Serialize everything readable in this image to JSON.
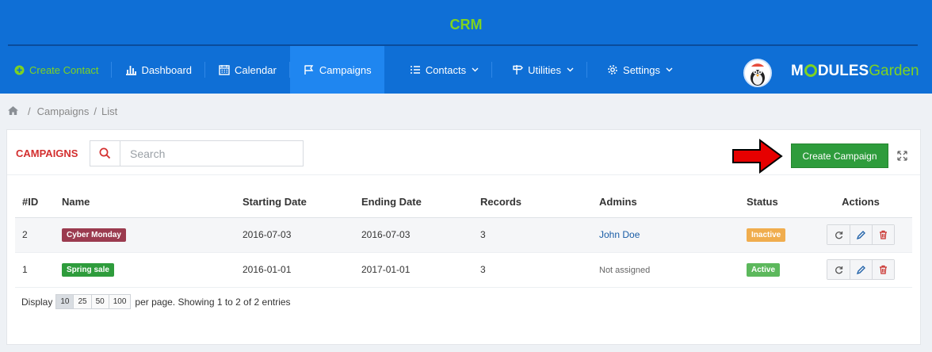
{
  "app": {
    "title": "CRM"
  },
  "nav": {
    "create_contact": "Create Contact",
    "items": [
      {
        "label": "Dashboard",
        "icon": "bar-chart-icon"
      },
      {
        "label": "Calendar",
        "icon": "calendar-icon"
      },
      {
        "label": "Campaigns",
        "icon": "flag-icon",
        "active": true
      },
      {
        "label": "Contacts",
        "icon": "list-icon",
        "dropdown": true
      },
      {
        "label": "Utilities",
        "icon": "signpost-icon",
        "dropdown": true
      },
      {
        "label": "Settings",
        "icon": "gear-icon",
        "dropdown": true
      }
    ],
    "logo": {
      "part1": "M",
      "part2": "DULES",
      "part3": "Garden"
    }
  },
  "breadcrumb": {
    "items": [
      "Campaigns",
      "List"
    ]
  },
  "card": {
    "title": "CAMPAIGNS",
    "search_placeholder": "Search",
    "create_button": "Create Campaign"
  },
  "table": {
    "headers": [
      "#ID",
      "Name",
      "Starting Date",
      "Ending Date",
      "Records",
      "Admins",
      "Status",
      "Actions"
    ],
    "rows": [
      {
        "id": "2",
        "name": "Cyber Monday",
        "name_color": "#9b3b4f",
        "start": "2016-07-03",
        "end": "2016-07-03",
        "records": "3",
        "admin": "John Doe",
        "status": "Inactive",
        "status_color": "#f0ad4e"
      },
      {
        "id": "1",
        "name": "Spring sale",
        "name_color": "#2e9c3c",
        "start": "2016-01-01",
        "end": "2017-01-01",
        "records": "3",
        "admin": "Not assigned",
        "status": "Active",
        "status_color": "#5cb85c"
      }
    ]
  },
  "footer": {
    "display": "Display",
    "page_sizes": [
      "10",
      "25",
      "50",
      "100"
    ],
    "selected_page_size": "10",
    "info": "per page. Showing 1 to 2 of 2 entries"
  }
}
